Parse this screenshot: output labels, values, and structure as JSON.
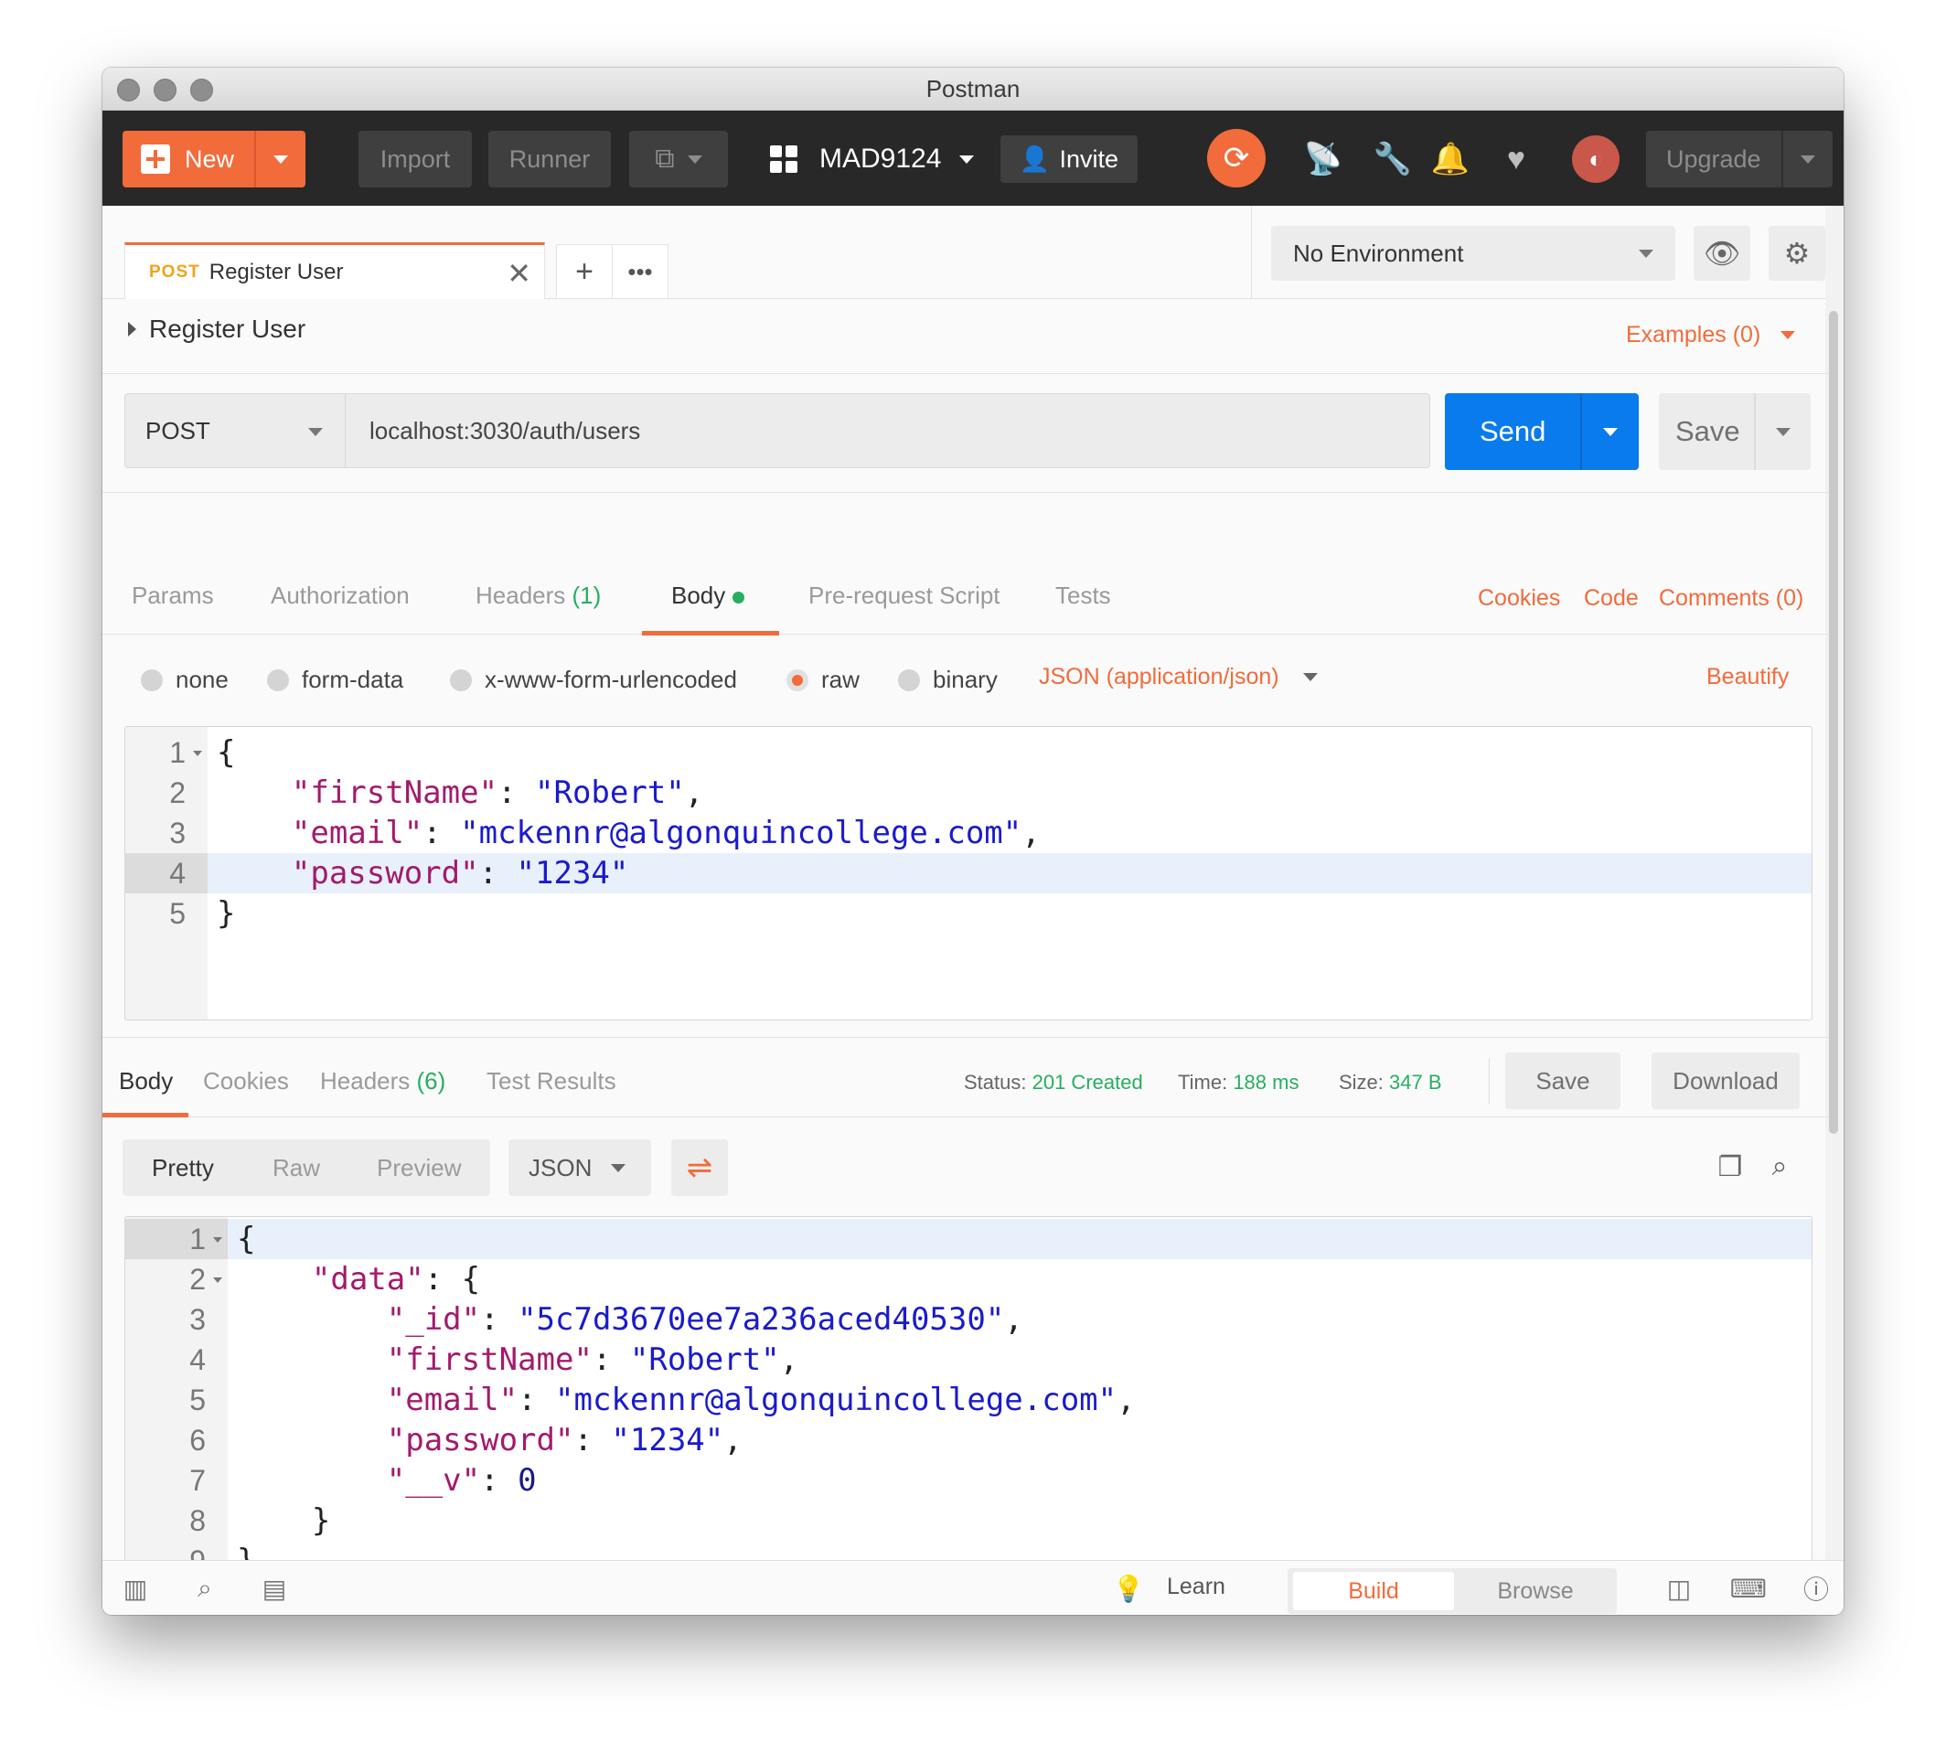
{
  "window": {
    "title": "Postman"
  },
  "header": {
    "new_label": "New",
    "import_label": "Import",
    "runner_label": "Runner",
    "workspace": "MAD9124",
    "invite_label": "Invite",
    "upgrade_label": "Upgrade"
  },
  "tab": {
    "method": "POST",
    "name": "Register User"
  },
  "environment": {
    "selected": "No Environment"
  },
  "request": {
    "title": "Register User",
    "examples": "Examples (0)",
    "method": "POST",
    "url": "localhost:3030/auth/users",
    "send_label": "Send",
    "save_label": "Save"
  },
  "request_tabs": {
    "params": "Params",
    "authorization": "Authorization",
    "headers": "Headers",
    "headers_count": "(1)",
    "body": "Body",
    "prerequest": "Pre-request Script",
    "tests": "Tests",
    "cookies": "Cookies",
    "code": "Code",
    "comments": "Comments (0)"
  },
  "body_options": {
    "none": "none",
    "form_data": "form-data",
    "urlencoded": "x-www-form-urlencoded",
    "raw": "raw",
    "binary": "binary",
    "content_type": "JSON (application/json)",
    "beautify": "Beautify",
    "selected": "raw"
  },
  "request_body": [
    "{",
    "    \"firstName\": \"Robert\",",
    "    \"email\": \"mckennr@algonquincollege.com\",",
    "    \"password\": \"1234\"",
    "}"
  ],
  "response_tabs": {
    "body": "Body",
    "cookies": "Cookies",
    "headers": "Headers",
    "headers_count": "(6)",
    "test_results": "Test Results"
  },
  "response_meta": {
    "status_label": "Status:",
    "status_value": "201 Created",
    "time_label": "Time:",
    "time_value": "188 ms",
    "size_label": "Size:",
    "size_value": "347 B",
    "save_label": "Save",
    "download_label": "Download"
  },
  "response_view": {
    "pretty": "Pretty",
    "raw": "Raw",
    "preview": "Preview",
    "format": "JSON"
  },
  "response_body": [
    "{",
    "    \"data\": {",
    "        \"_id\": \"5c7d3670ee7a236aced40530\",",
    "        \"firstName\": \"Robert\",",
    "        \"email\": \"mckennr@algonquincollege.com\",",
    "        \"password\": \"1234\",",
    "        \"__v\": 0",
    "    }",
    "}"
  ],
  "footer": {
    "learn": "Learn",
    "build": "Build",
    "browse": "Browse"
  },
  "colors": {
    "accent": "#f26b3a",
    "send": "#097bed",
    "success": "#27ae60"
  }
}
